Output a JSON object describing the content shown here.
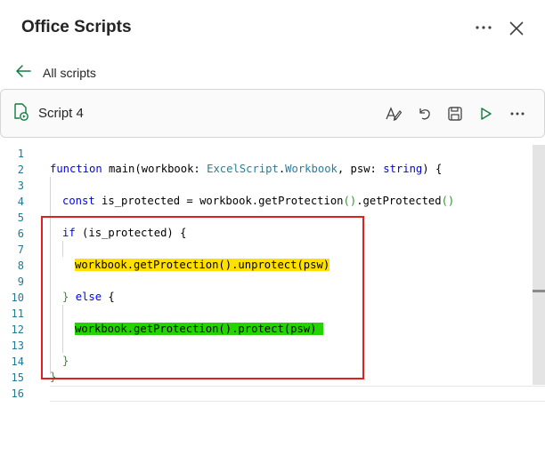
{
  "header": {
    "title": "Office Scripts"
  },
  "nav": {
    "back_label": "All scripts"
  },
  "script": {
    "name": "Script 4"
  },
  "editor": {
    "line_numbers": [
      "1",
      "2",
      "3",
      "4",
      "5",
      "6",
      "7",
      "8",
      "9",
      "10",
      "11",
      "12",
      "13",
      "14",
      "15",
      "16"
    ],
    "code": {
      "l2_kw_function": "function",
      "l2_a": " main(workbook: ",
      "l2_type1": "ExcelScript",
      "l2_b": ".",
      "l2_type2": "Workbook",
      "l2_c": ", psw: ",
      "l2_kw_string": "string",
      "l2_d": ") {",
      "l4_kw_const": "const",
      "l4_a": " is_protected = workbook.getProtection",
      "l4_p1": "()",
      "l4_b": ".getProtected",
      "l4_p2": "()",
      "l6_kw_if": "if",
      "l6_a": " (is_protected) {",
      "l8_code": "workbook.getProtection().unprotect(psw)",
      "l10_a": "} ",
      "l10_kw_else": "else",
      "l10_b": " {",
      "l12_code": "workbook.getProtection().protect(psw) ",
      "l14_a": "}",
      "l15_a": "}"
    }
  },
  "colors": {
    "keyword": "#0000ff",
    "type": "#267f99",
    "highlight_yellow": "#ffe000",
    "highlight_green": "#24d400",
    "annotation_box": "#e02020"
  }
}
